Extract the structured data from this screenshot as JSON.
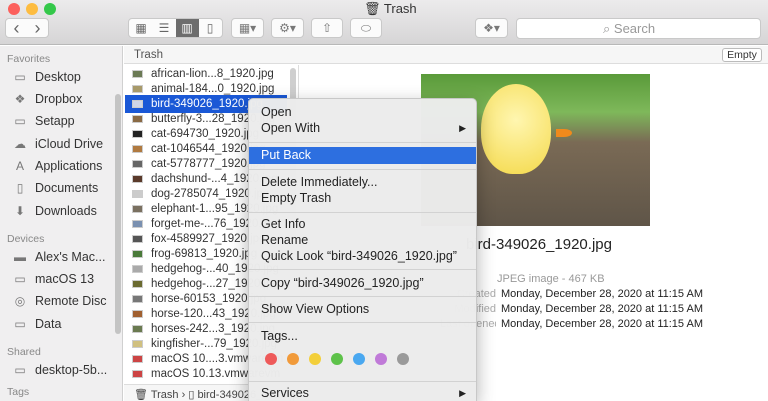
{
  "window": {
    "title": "Trash"
  },
  "toolbar": {
    "back": "‹",
    "forward": "›",
    "search_placeholder": "Search"
  },
  "sidebar": {
    "favorites_label": "Favorites",
    "favorites": [
      {
        "label": "Desktop",
        "icon": "folder-icon"
      },
      {
        "label": "Dropbox",
        "icon": "dropbox-icon"
      },
      {
        "label": "Setapp",
        "icon": "folder-icon"
      },
      {
        "label": "iCloud Drive",
        "icon": "cloud-icon"
      },
      {
        "label": "Applications",
        "icon": "applications-icon"
      },
      {
        "label": "Documents",
        "icon": "document-icon"
      },
      {
        "label": "Downloads",
        "icon": "download-icon"
      }
    ],
    "devices_label": "Devices",
    "devices": [
      {
        "label": "Alex's Mac...",
        "icon": "laptop-icon"
      },
      {
        "label": "macOS 13",
        "icon": "disk-icon"
      },
      {
        "label": "Remote Disc",
        "icon": "disc-icon"
      },
      {
        "label": "Data",
        "icon": "disk-icon"
      }
    ],
    "shared_label": "Shared",
    "shared": [
      {
        "label": "desktop-5b...",
        "icon": "computer-icon"
      }
    ],
    "tags_label": "Tags"
  },
  "column": {
    "header": "Trash",
    "empty_button": "Empty",
    "files": [
      "african-lion...8_1920.jpg",
      "animal-184...0_1920.jpg",
      "bird-349026_1920.jpg",
      "butterfly-3...28_1920.jpg",
      "cat-694730_1920.jpg",
      "cat-1046544_1920.jpg",
      "cat-5778777_1920.jpg",
      "dachshund-...4_1920.jpg",
      "dog-2785074_1920.jpg",
      "elephant-1...95_1920.jpg",
      "forget-me-...76_1920.jpg",
      "fox-4589927_1920.jpg",
      "frog-69813_1920.jpg",
      "hedgehog-...40_1920.jpg",
      "hedgehog-...27_1920.jpg",
      "horse-60153_1920.jpg",
      "horse-120...43_1920.jpg",
      "horses-242...3_1920.jpg",
      "kingfisher-...79_1920.jpg",
      "macOS 10....3.vmwarevm",
      "macOS 10.13.vmwarevm"
    ],
    "selected_index": 2
  },
  "path_bar": {
    "root": "Trash",
    "item": "bird-349026_1920.jpg"
  },
  "preview": {
    "filename": "bird-349026_1920.jpg",
    "kind": "JPEG image - 467 KB",
    "meta": [
      {
        "label": "Created",
        "value": "Monday, December 28, 2020 at 11:15 AM"
      },
      {
        "label": "Modified",
        "value": "Monday, December 28, 2020 at 11:15 AM"
      },
      {
        "label": "Last opened",
        "value": "Monday, December 28, 2020 at 11:15 AM"
      }
    ]
  },
  "context_menu": {
    "open": "Open",
    "open_with": "Open With",
    "put_back": "Put Back",
    "delete_immediately": "Delete Immediately...",
    "empty_trash": "Empty Trash",
    "get_info": "Get Info",
    "rename": "Rename",
    "quick_look": "Quick Look “bird-349026_1920.jpg”",
    "copy": "Copy “bird-349026_1920.jpg”",
    "show_view_options": "Show View Options",
    "tags": "Tags...",
    "services": "Services",
    "tag_colors": [
      "#ee5a5a",
      "#f19a3a",
      "#f3cf3a",
      "#5ec24a",
      "#4aa8f0",
      "#c07ad8",
      "#9a9a9a"
    ]
  }
}
